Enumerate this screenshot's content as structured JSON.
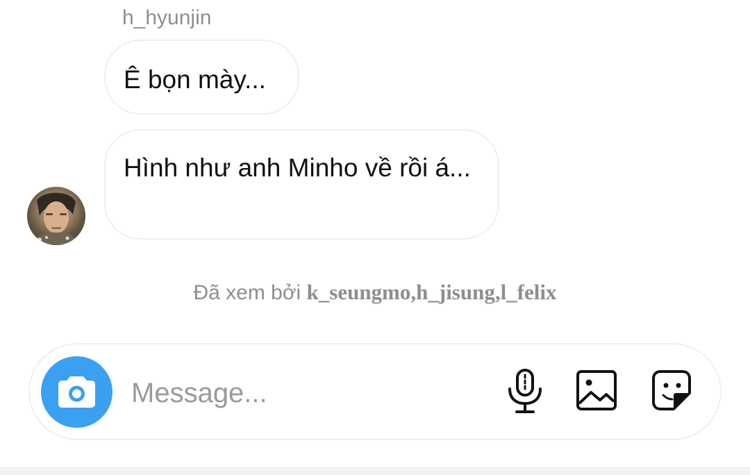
{
  "conversation": {
    "sender_name": "h_hyunjin",
    "messages": [
      {
        "text": "Ê bọn mày..."
      },
      {
        "text": "Hình như anh Minho về rồi á..."
      }
    ],
    "seen": {
      "prefix": "Đã xem bởi ",
      "names": "k_seungmo,h_jisung,l_felix"
    }
  },
  "composer": {
    "placeholder": "Message..."
  },
  "icons": {
    "camera": "camera-icon",
    "mic": "microphone-icon",
    "gallery": "gallery-icon",
    "sticker": "sticker-icon"
  },
  "colors": {
    "camera_button": "#3aa0f2",
    "secondary_text": "#8e8e8e",
    "bubble_border": "#efefef"
  }
}
